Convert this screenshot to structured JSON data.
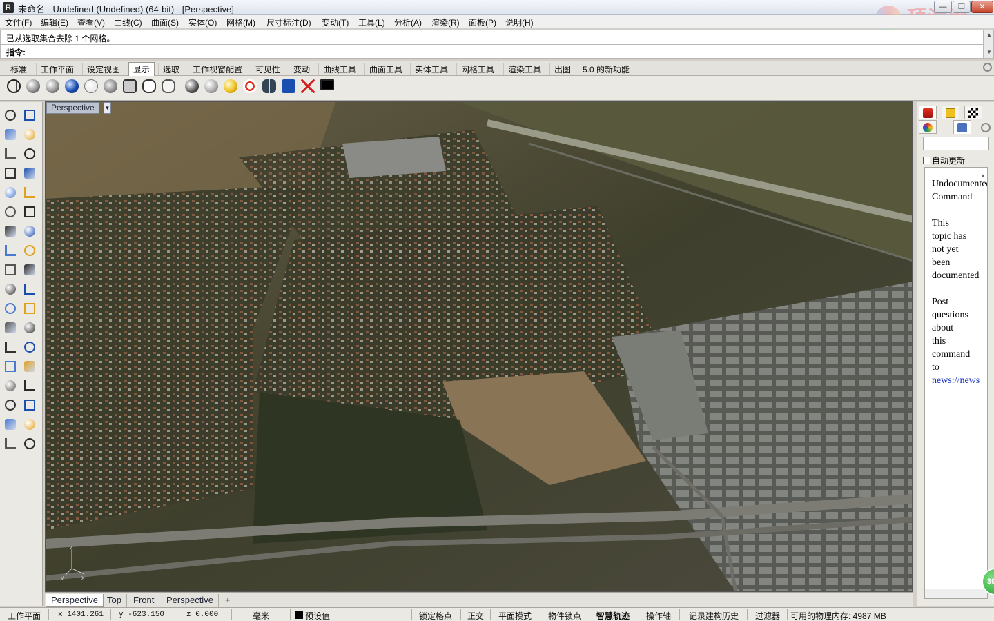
{
  "window": {
    "title": "未命名 - Undefined (Undefined) (64-bit) - [Perspective]",
    "icon_glyph": "R",
    "watermark": {
      "cn": "顶渲网",
      "en": "toprender.com"
    },
    "controls": {
      "minimize": "—",
      "maximize": "❐",
      "close": "✕"
    }
  },
  "menu": [
    "文件(F)",
    "编辑(E)",
    "查看(V)",
    "曲线(C)",
    "曲面(S)",
    "实体(O)",
    "网格(M)",
    "尺寸标注(D)",
    "变动(T)",
    "工具(L)",
    "分析(A)",
    "渲染(R)",
    "面板(P)",
    "说明(H)"
  ],
  "command": {
    "history": "已从选取集合去除 1 个网格。",
    "prompt": "指令:",
    "input_value": ""
  },
  "toolbar_tabs": [
    "标准",
    "工作平面",
    "设定视图",
    "显示",
    "选取",
    "工作视窗配置",
    "可见性",
    "变动",
    "曲线工具",
    "曲面工具",
    "实体工具",
    "网格工具",
    "渲染工具",
    "出图",
    "5.0 的新功能"
  ],
  "active_toolbar_tab": "显示",
  "display_icons": [
    "wireframe-icon",
    "shaded-icon",
    "rendered-icon",
    "rendered-blue-icon",
    "ghosted-icon",
    "xray-icon",
    "technical-icon",
    "artistic-icon",
    "pen-icon",
    "globe-mode-icon",
    "sphere-gray-icon",
    "sphere-yellow-icon",
    "target-icon",
    "glasses-icon",
    "camera-icon",
    "close-red-icon",
    "monitor-icon"
  ],
  "viewport": {
    "label": "Perspective",
    "dropdown_glyph": "▼",
    "axes": {
      "x": "x",
      "y": "y",
      "z": "z"
    }
  },
  "viewport_tabs": [
    "Perspective",
    "Top",
    "Front",
    "Perspective"
  ],
  "viewport_tab_add": "+",
  "right_panel": {
    "auto_update_label": "自动更新",
    "help_paragraphs": [
      [
        "Undocumented",
        "Command"
      ],
      [
        "This",
        "topic has",
        "not yet",
        "been",
        "documented"
      ],
      [
        "Post",
        "questions",
        "about",
        "this",
        "command",
        "to"
      ]
    ],
    "help_link": "news://news",
    "badge": "39"
  },
  "status_bar": {
    "cplane": "工作平面",
    "x": "x 1401.261",
    "y": "y -623.150",
    "z": "z 0.000",
    "units": "毫米",
    "layer": "预设值",
    "toggles": [
      "锁定格点",
      "正交",
      "平面模式",
      "物件锁点",
      "智慧轨迹",
      "操作轴",
      "记录建构历史",
      "过滤器"
    ],
    "memory": "可用的物理内存: 4987 MB"
  },
  "colors": {
    "accent_blue": "#1a4fb0",
    "close_red": "#c8442c",
    "link": "#1030c0",
    "badge_green": "#1d9a2f"
  }
}
